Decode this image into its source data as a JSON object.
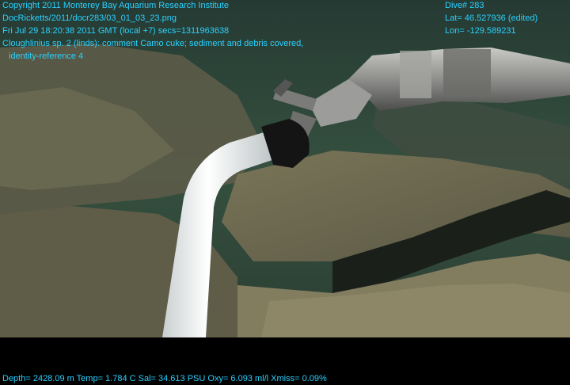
{
  "overlay": {
    "line1": "Copyright 2011 Monterey Bay Aquarium Research Institute",
    "line2": "DocRicketts/2011/docr283/03_01_03_23.png",
    "line3": "Fri Jul 29 18:20:38 2011 GMT (local +7)  secs=1311963638",
    "line4": "Cloughlinius sp. 2 (linds): comment Camo cuke; sediment and debris covered,",
    "line5": "identity-reference 4",
    "dive": "Dive# 283",
    "lat": "Lat= 46.527936 (edited)",
    "lon": "Lon= -129.589231",
    "sensors": "Depth= 2428.09 m  Temp= 1.784 C  Sal= 34.613 PSU  Oxy= 6.093 ml/l  Xmiss= 0.09%"
  },
  "colors": {
    "overlay_text": "#2ad1ff",
    "letterbox": "#000000",
    "water": "#2f463e",
    "rock": "#6e6a52",
    "tube": "#f2f4f3"
  }
}
